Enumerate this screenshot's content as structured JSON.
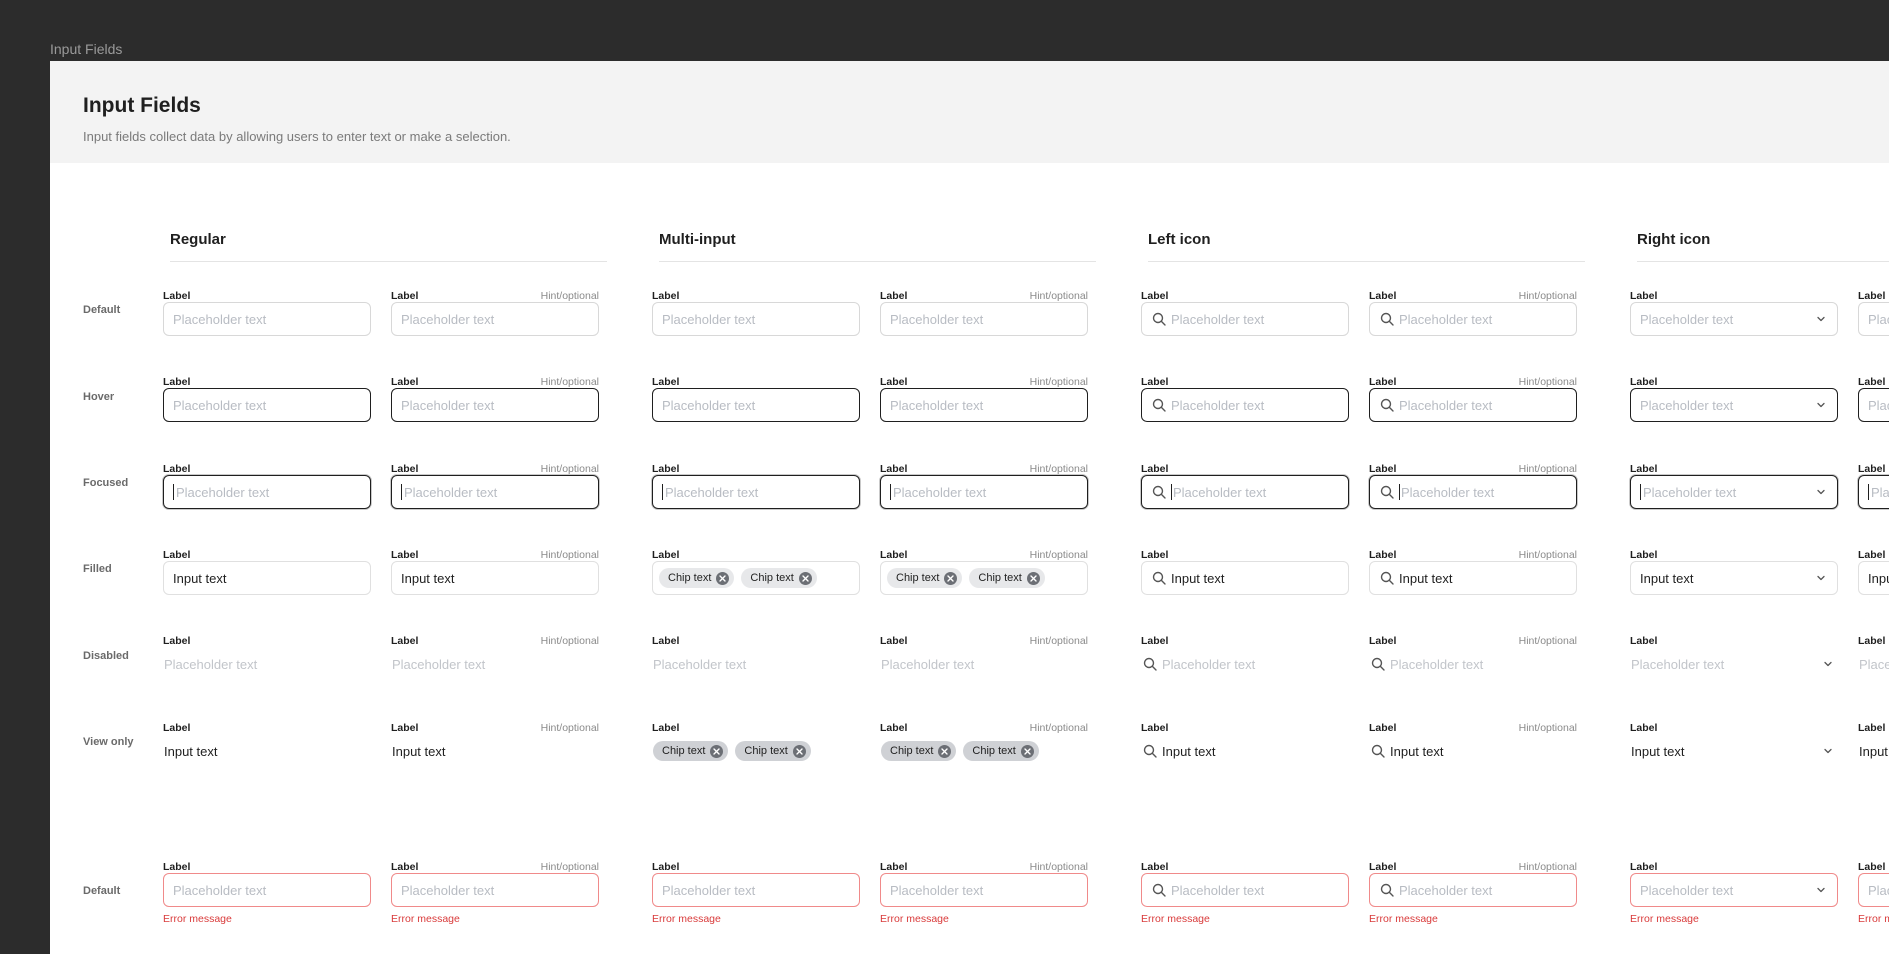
{
  "frame_label": "Input Fields",
  "header": {
    "title": "Input Fields",
    "description": "Input fields collect data by allowing users to enter text or make a selection."
  },
  "sections": [
    {
      "title": "Regular",
      "type": "regular"
    },
    {
      "title": "Multi-input",
      "type": "multi"
    },
    {
      "title": "Left icon",
      "type": "left-icon"
    },
    {
      "title": "Right icon",
      "type": "right-icon"
    }
  ],
  "row_labels": [
    "Default",
    "Hover",
    "Focused",
    "Filled",
    "Disabled",
    "View only",
    "Default"
  ],
  "field": {
    "label": "Label",
    "hint": "Hint/optional",
    "placeholder": "Placeholder text",
    "value": "Input text",
    "chip": "Chip text",
    "error": "Error message"
  },
  "icons": {
    "left": "search-icon",
    "right": "chevron-down-icon",
    "chip_remove": "close-circle-icon"
  },
  "colors": {
    "error": "#d93a3a",
    "error_border": "#f08a8a",
    "focus_border": "#1f1f1f",
    "placeholder": "#b8bcc3",
    "chip_bg": "#e7e8ea"
  }
}
